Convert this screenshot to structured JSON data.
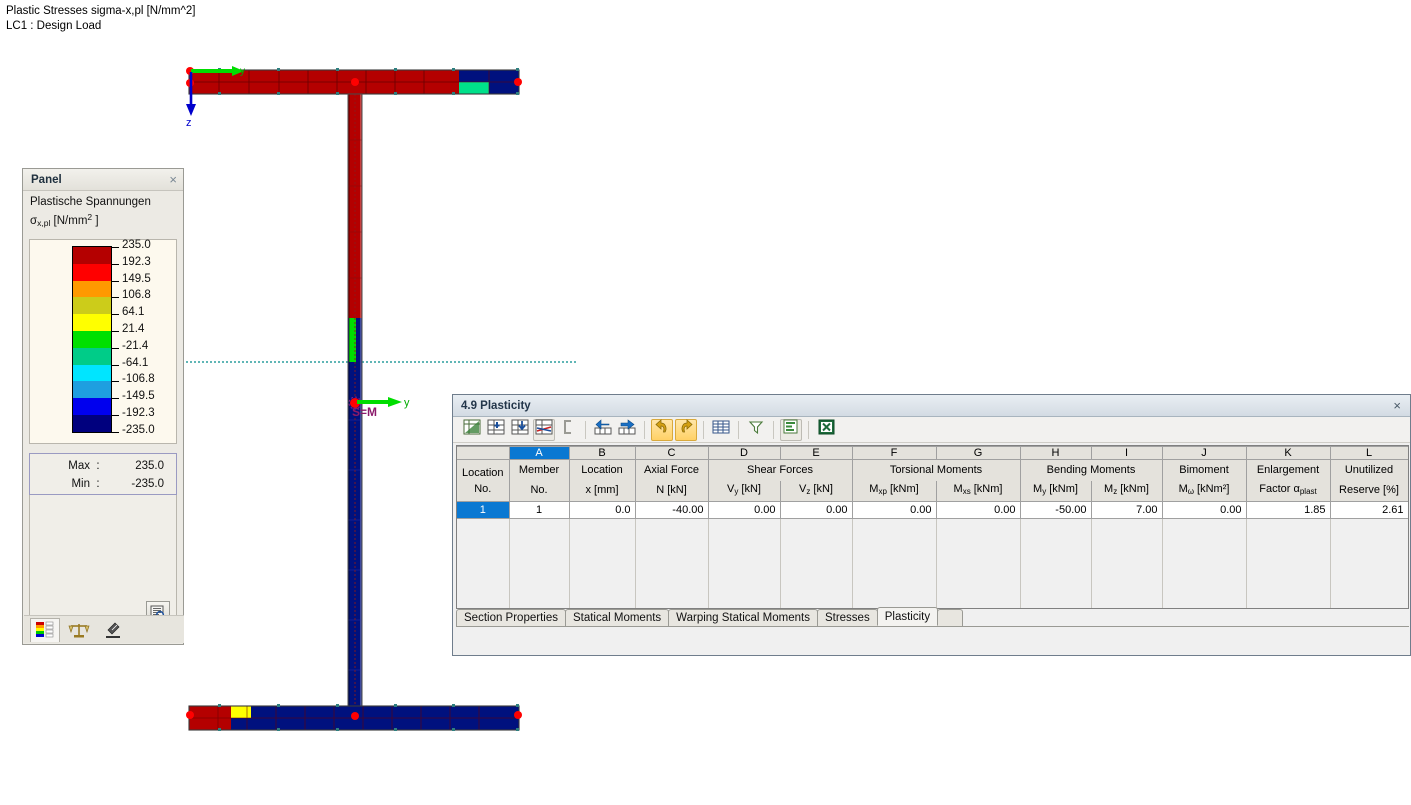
{
  "header": {
    "line1": "Plastic Stresses sigma-x,pl [N/mm^2]",
    "line2": "LC1 : Design Load"
  },
  "panel": {
    "title": "Panel",
    "close_label": "×",
    "legend_title": "Plastische Spannungen",
    "legend_symbol_main": "σ",
    "legend_symbol_sub": "x,pl",
    "legend_unit_prefix": " [N/mm",
    "legend_unit_sup": "2",
    "legend_unit_suffix": " ]",
    "scale_labels": [
      "235.0",
      "192.3",
      "149.5",
      "106.8",
      "64.1",
      "21.4",
      "-21.4",
      "-64.1",
      "-106.8",
      "-149.5",
      "-192.3",
      "-235.0"
    ],
    "scale_colors": [
      "#b40000",
      "#ff0000",
      "#ff9900",
      "#cccc1a",
      "#ffff00",
      "#00e000",
      "#00cc88",
      "#00e5ff",
      "#1e9fe0",
      "#0000ee",
      "#00007e"
    ],
    "max_label": "Max",
    "min_label": "Min",
    "colon": ":",
    "max_value": "235.0",
    "min_value": "-235.0",
    "zoom_icon": "zoom-icon",
    "tabs": [
      {
        "name": "color-scale-tab",
        "icon": "color-bars-icon"
      },
      {
        "name": "factors-tab",
        "icon": "balance-scale-icon"
      },
      {
        "name": "view-tab",
        "icon": "microscope-icon"
      }
    ]
  },
  "model": {
    "axis_y_label": "y",
    "axis_z_label": "z",
    "axis_y_label_top": "y",
    "centroid_label": "S=M",
    "colors": {
      "red_dark": "#b40000",
      "red": "#cc0000",
      "blue_dark": "#00007e",
      "blue": "#0000cc",
      "green": "#00e08a",
      "yellow": "#ffff00",
      "node": "#ff0000",
      "axis_green": "#00dd00",
      "axis_blue": "#0000cc",
      "dotted_line": "#008b8b"
    }
  },
  "dialog": {
    "title": "4.9 Plasticity",
    "close_label": "×",
    "toolbar": [
      {
        "name": "edit-table-button",
        "icon": "table-edit-icon",
        "state": "normal"
      },
      {
        "name": "insert-row-button",
        "icon": "row-insert-icon",
        "state": "normal"
      },
      {
        "name": "delete-row-button",
        "icon": "row-delete-icon",
        "state": "normal"
      },
      {
        "name": "table-settings-button",
        "icon": "table-settings-icon",
        "state": "framed"
      },
      {
        "name": "selection-button",
        "icon": "bracket-icon",
        "state": "normal"
      },
      {
        "name": "previous-table-button",
        "icon": "arrow-left-table-icon",
        "state": "normal"
      },
      {
        "name": "next-table-button",
        "icon": "arrow-right-table-icon",
        "state": "normal"
      },
      {
        "name": "undo-button",
        "icon": "undo-arrow-icon",
        "state": "active"
      },
      {
        "name": "redo-button",
        "icon": "redo-arrow-icon",
        "state": "active"
      },
      {
        "name": "grid-view-button",
        "icon": "grid-icon",
        "state": "normal"
      },
      {
        "name": "filter-button",
        "icon": "funnel-icon",
        "state": "normal"
      },
      {
        "name": "chart-button",
        "icon": "bar-chart-icon",
        "state": "framed"
      },
      {
        "name": "export-excel-button",
        "icon": "excel-icon",
        "state": "normal"
      }
    ],
    "column_letters": [
      "",
      "A",
      "B",
      "C",
      "D",
      "E",
      "F",
      "G",
      "H",
      "I",
      "J",
      "K",
      "L"
    ],
    "selected_column_letter": "A",
    "row_header": {
      "line1": "Location",
      "line2": "No."
    },
    "column_groups": [
      {
        "label": "Member",
        "span": 1
      },
      {
        "label": "Location",
        "span": 1
      },
      {
        "label": "Axial Force",
        "span": 1
      },
      {
        "label": "Shear Forces",
        "span": 2
      },
      {
        "label": "Torsional Moments",
        "span": 2
      },
      {
        "label": "Bending Moments",
        "span": 2
      },
      {
        "label": "Bimoment",
        "span": 1
      },
      {
        "label": "Enlargement",
        "span": 1
      },
      {
        "label": "Unutilized",
        "span": 1
      }
    ],
    "column_units": [
      {
        "text": "No.",
        "sub": "",
        "tail": ""
      },
      {
        "text": "x [mm]",
        "sub": "",
        "tail": ""
      },
      {
        "text": "N [kN]",
        "sub": "",
        "tail": ""
      },
      {
        "text": "V",
        "sub": "y",
        "tail": " [kN]"
      },
      {
        "text": "V",
        "sub": "z",
        "tail": " [kN]"
      },
      {
        "text": "M",
        "sub": "xp",
        "tail": " [kNm]"
      },
      {
        "text": "M",
        "sub": "xs",
        "tail": " [kNm]"
      },
      {
        "text": "M",
        "sub": "y",
        "tail": " [kNm]"
      },
      {
        "text": "M",
        "sub": "z",
        "tail": " [kNm]"
      },
      {
        "text": "M",
        "sub": "ω",
        "tail": " [kNm²]"
      },
      {
        "text": "Factor α",
        "sub": "plast",
        "tail": ""
      },
      {
        "text": "Reserve [%]",
        "sub": "",
        "tail": ""
      }
    ],
    "rows": [
      {
        "location_no": "1",
        "values": [
          "1",
          "0.0",
          "-40.00",
          "0.00",
          "0.00",
          "0.00",
          "0.00",
          "-50.00",
          "7.00",
          "0.00",
          "1.85",
          "2.61"
        ]
      }
    ],
    "tabs": [
      {
        "label": "Section Properties",
        "active": false
      },
      {
        "label": "Statical Moments",
        "active": false
      },
      {
        "label": "Warping Statical Moments",
        "active": false
      },
      {
        "label": "Stresses",
        "active": false
      },
      {
        "label": "Plasticity",
        "active": true
      }
    ]
  }
}
